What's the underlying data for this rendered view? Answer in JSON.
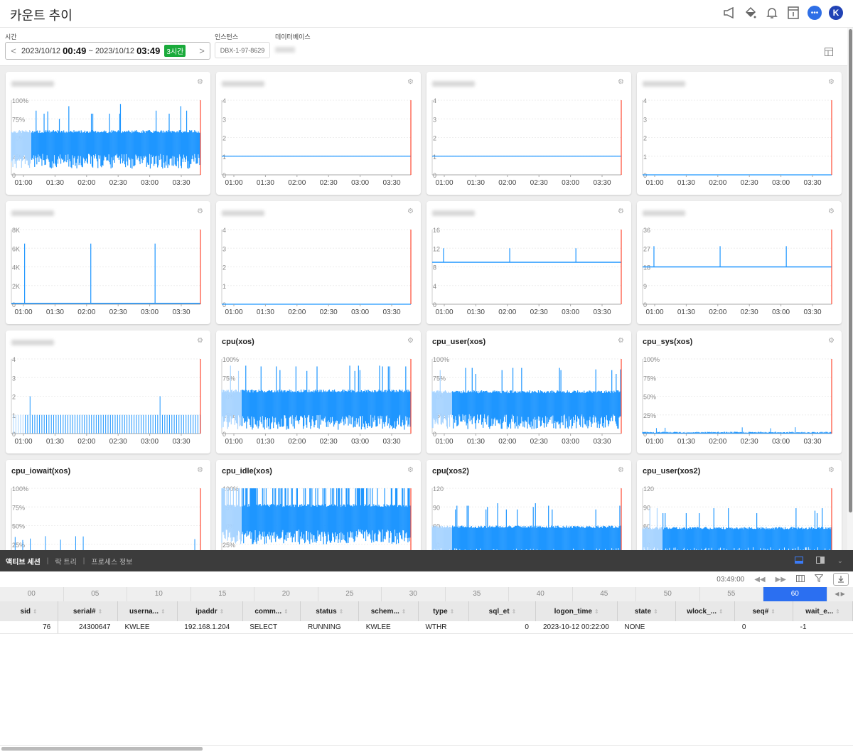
{
  "header": {
    "title": "카운트 추이",
    "icons": [
      "megaphone-icon",
      "paint-bucket-icon",
      "bell-icon",
      "info-book-icon",
      "chat-icon",
      "avatar"
    ],
    "avatar_initial": "K"
  },
  "filters": {
    "time_label": "시간",
    "instance_label": "인스턴스",
    "database_label": "데이터베이스",
    "start_date": "2023/10/12",
    "start_time": "00:49",
    "separator": "~",
    "end_date": "2023/10/12",
    "end_time": "03:49",
    "range_badge": "3시간",
    "instance_value": "DBX-1-97-8629",
    "database_value": "(redacted)"
  },
  "charts": [
    {
      "title": "",
      "redacted": true,
      "kind": "noisy",
      "yticks": [
        "100%",
        "75%",
        "50%",
        "25%",
        "0"
      ],
      "ymax": 100,
      "base": 42,
      "amp": 14,
      "spikes": [
        95,
        86,
        82,
        92,
        85,
        82,
        75
      ]
    },
    {
      "title": "",
      "redacted": true,
      "kind": "flat",
      "yticks": [
        "4",
        "3",
        "2",
        "1",
        "0"
      ],
      "ymax": 4,
      "base": 1
    },
    {
      "title": "",
      "redacted": true,
      "kind": "flat",
      "yticks": [
        "4",
        "3",
        "2",
        "1",
        "0"
      ],
      "ymax": 4,
      "base": 1
    },
    {
      "title": "",
      "redacted": true,
      "kind": "flat",
      "yticks": [
        "4",
        "3",
        "2",
        "1",
        "0"
      ],
      "ymax": 4,
      "base": 0
    },
    {
      "title": "",
      "redacted": true,
      "kind": "spikes",
      "yticks": [
        "8K",
        "6K",
        "4K",
        "2K",
        "0"
      ],
      "ymax": 8000,
      "base": 100,
      "spike_val": 6500,
      "spike_at": [
        0.07,
        0.42,
        0.76
      ]
    },
    {
      "title": "",
      "redacted": true,
      "kind": "flat",
      "yticks": [
        "4",
        "3",
        "2",
        "1",
        "0"
      ],
      "ymax": 4,
      "base": 0
    },
    {
      "title": "",
      "redacted": true,
      "kind": "spikes",
      "yticks": [
        "16",
        "12",
        "8",
        "4",
        "0"
      ],
      "ymax": 16,
      "base": 9,
      "spike_val": 12,
      "spike_at": [
        0.06,
        0.41,
        0.76
      ]
    },
    {
      "title": "",
      "redacted": true,
      "kind": "spikes",
      "yticks": [
        "36",
        "27",
        "18",
        "9",
        "0"
      ],
      "ymax": 36,
      "base": 18,
      "spike_val": 28,
      "spike_at": [
        0.06,
        0.41,
        0.76
      ]
    },
    {
      "title": "",
      "redacted": true,
      "kind": "bars",
      "yticks": [
        "4",
        "3",
        "2",
        "1",
        "0"
      ],
      "ymax": 4,
      "base": 1
    },
    {
      "title": "cpu(xos)",
      "redacted": false,
      "kind": "noisy",
      "yticks": [
        "100%",
        "75%",
        "50%",
        "25%",
        "0"
      ],
      "ymax": 100,
      "base": 40,
      "amp": 15,
      "spikes": [
        96,
        90,
        90,
        91,
        85,
        84
      ]
    },
    {
      "title": "cpu_user(xos)",
      "redacted": false,
      "kind": "noisy",
      "yticks": [
        "100%",
        "75%",
        "50%",
        "25%",
        "0"
      ],
      "ymax": 100,
      "base": 40,
      "amp": 14,
      "spikes": [
        88,
        80,
        86,
        88,
        85
      ]
    },
    {
      "title": "cpu_sys(xos)",
      "redacted": false,
      "kind": "low",
      "yticks": [
        "100%",
        "75%",
        "50%",
        "25%",
        "0"
      ],
      "ymax": 100,
      "base": 1
    },
    {
      "title": "cpu_iowait(xos)",
      "redacted": false,
      "kind": "sparse",
      "yticks": [
        "100%",
        "75%",
        "50%",
        "25%"
      ],
      "ymax": 100,
      "base": 0
    },
    {
      "title": "cpu_idle(xos)",
      "redacted": false,
      "kind": "noisy",
      "yticks": [
        "100%",
        "75%",
        "50%",
        "25%"
      ],
      "ymax": 100,
      "base": 60,
      "amp": 15,
      "spikes": []
    },
    {
      "title": "cpu(xos2)",
      "redacted": false,
      "kind": "noisy",
      "yticks": [
        "120",
        "90",
        "60",
        "30"
      ],
      "ymax": 120,
      "base": 40,
      "amp": 16,
      "spikes": [
        96,
        90,
        92,
        86
      ]
    },
    {
      "title": "cpu_user(xos2)",
      "redacted": false,
      "kind": "noisy",
      "yticks": [
        "120",
        "90",
        "60",
        "30"
      ],
      "ymax": 120,
      "base": 40,
      "amp": 14,
      "spikes": [
        88,
        80,
        88,
        84
      ]
    }
  ],
  "xticks": [
    "01:00",
    "01:30",
    "02:00",
    "02:30",
    "03:00",
    "03:30"
  ],
  "bottom": {
    "tabs": [
      {
        "label": "액티브 세션",
        "active": true
      },
      {
        "label": "락 트리",
        "active": false
      },
      {
        "label": "프로세스 정보",
        "active": false
      }
    ],
    "current_time": "03:49:00",
    "timeline": [
      "00",
      "05",
      "10",
      "15",
      "20",
      "25",
      "30",
      "35",
      "40",
      "45",
      "50",
      "55",
      "60"
    ],
    "timeline_selected": "60",
    "columns": [
      "sid",
      "serial#",
      "userna...",
      "ipaddr",
      "comm...",
      "status",
      "schem...",
      "type",
      "sql_et",
      "logon_time",
      "state",
      "wlock_...",
      "seq#",
      "wait_e..."
    ],
    "rows": [
      [
        "76",
        "24300647",
        "KWLEE",
        "192.168.1.204",
        "SELECT",
        "RUNNING",
        "KWLEE",
        "WTHR",
        "0",
        "2023-10-12 00:22:00",
        "NONE",
        "",
        "0",
        "-1"
      ]
    ]
  }
}
